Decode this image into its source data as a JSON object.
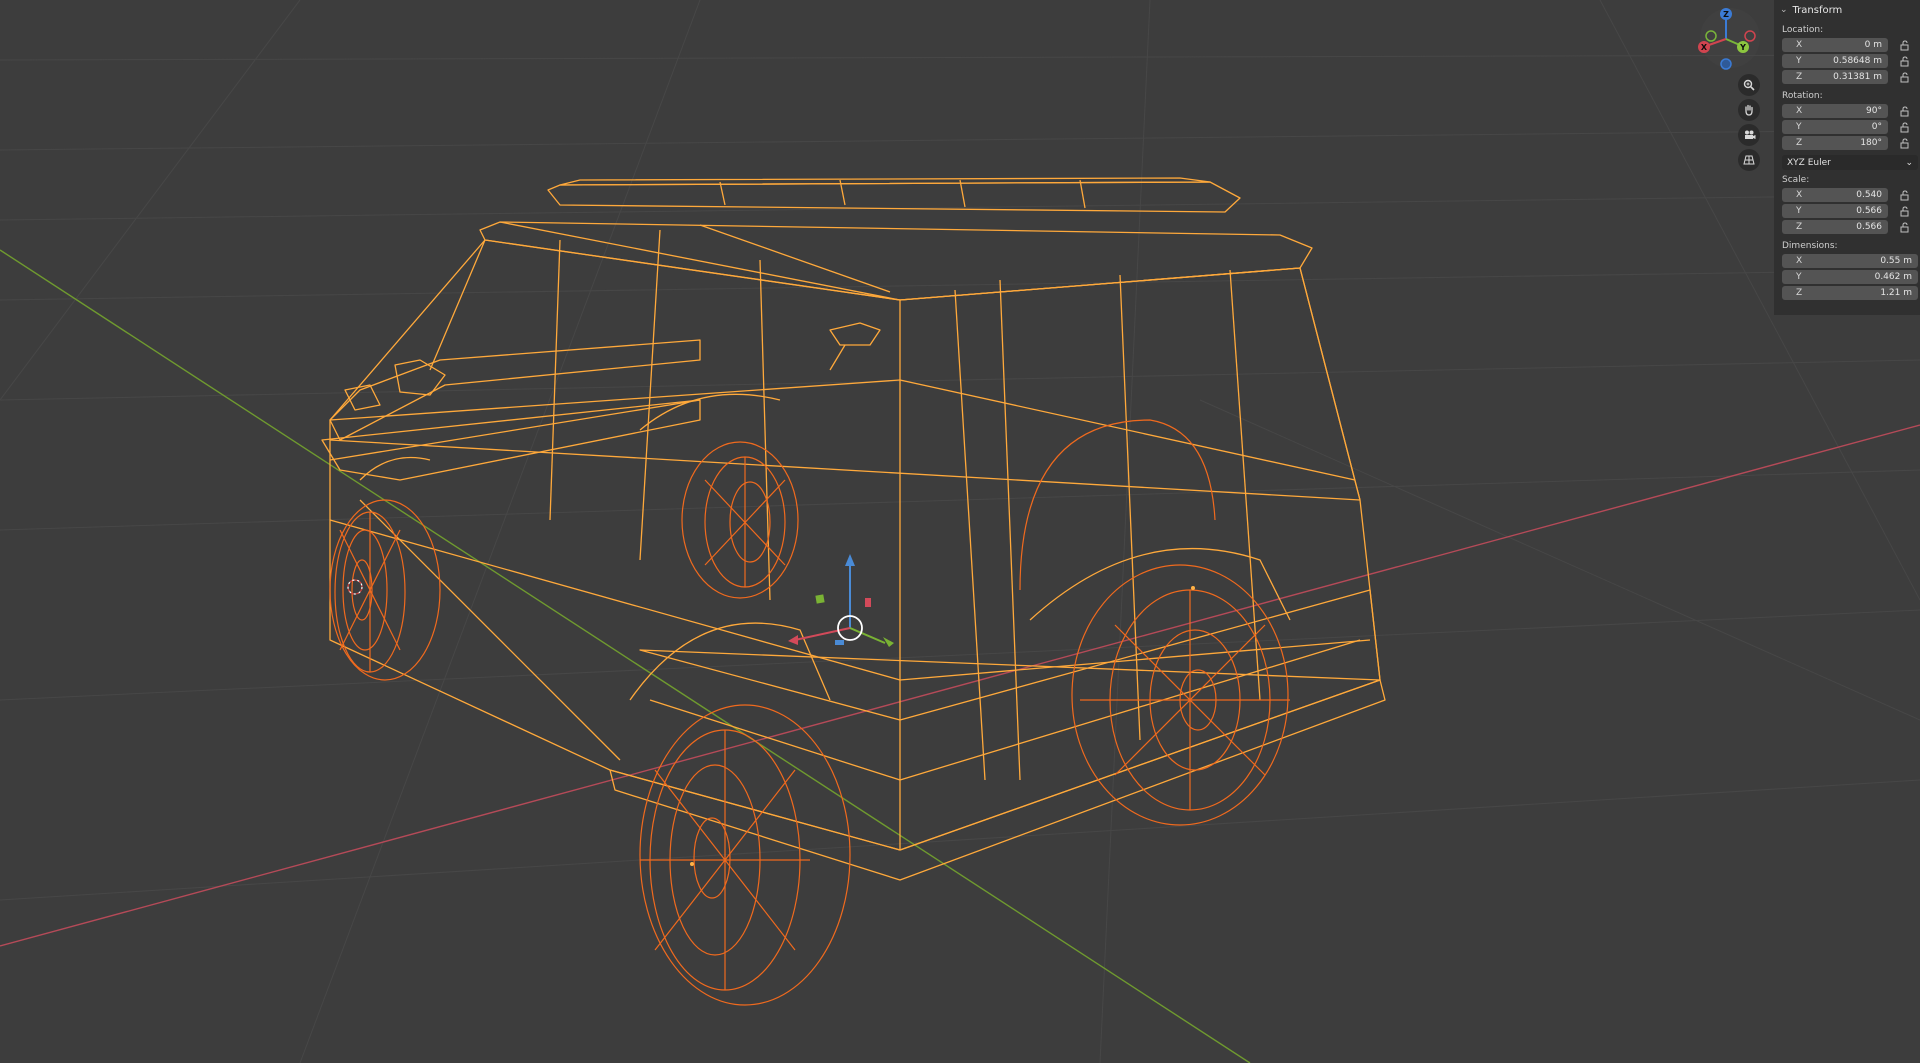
{
  "viewport": {
    "gizmo_axes": {
      "z": "Z",
      "x": "X",
      "y": "Y"
    },
    "nav_tools": [
      {
        "name": "zoom-icon"
      },
      {
        "name": "pan-hand-icon"
      },
      {
        "name": "camera-icon"
      },
      {
        "name": "grid-perspective-icon"
      }
    ],
    "colors": {
      "background": "#3d3d3d",
      "grid": "#4a4a4a",
      "x_axis": "#b54a58",
      "y_axis": "#6f9a2f",
      "wireframe_body": "#ffa93b",
      "wireframe_wheels": "#f06a1e"
    }
  },
  "sidebar": {
    "panel_title": "Transform",
    "location": {
      "label": "Location:",
      "x": {
        "axis": "X",
        "value": "0 m"
      },
      "y": {
        "axis": "Y",
        "value": "0.58648 m"
      },
      "z": {
        "axis": "Z",
        "value": "0.31381 m"
      }
    },
    "rotation": {
      "label": "Rotation:",
      "x": {
        "axis": "X",
        "value": "90°"
      },
      "y": {
        "axis": "Y",
        "value": "0°"
      },
      "z": {
        "axis": "Z",
        "value": "180°"
      },
      "mode": "XYZ Euler"
    },
    "scale": {
      "label": "Scale:",
      "x": {
        "axis": "X",
        "value": "0.540"
      },
      "y": {
        "axis": "Y",
        "value": "0.566"
      },
      "z": {
        "axis": "Z",
        "value": "0.566"
      }
    },
    "dimensions": {
      "label": "Dimensions:",
      "x": {
        "axis": "X",
        "value": "0.55 m"
      },
      "y": {
        "axis": "Y",
        "value": "0.462 m"
      },
      "z": {
        "axis": "Z",
        "value": "1.21 m"
      }
    }
  }
}
